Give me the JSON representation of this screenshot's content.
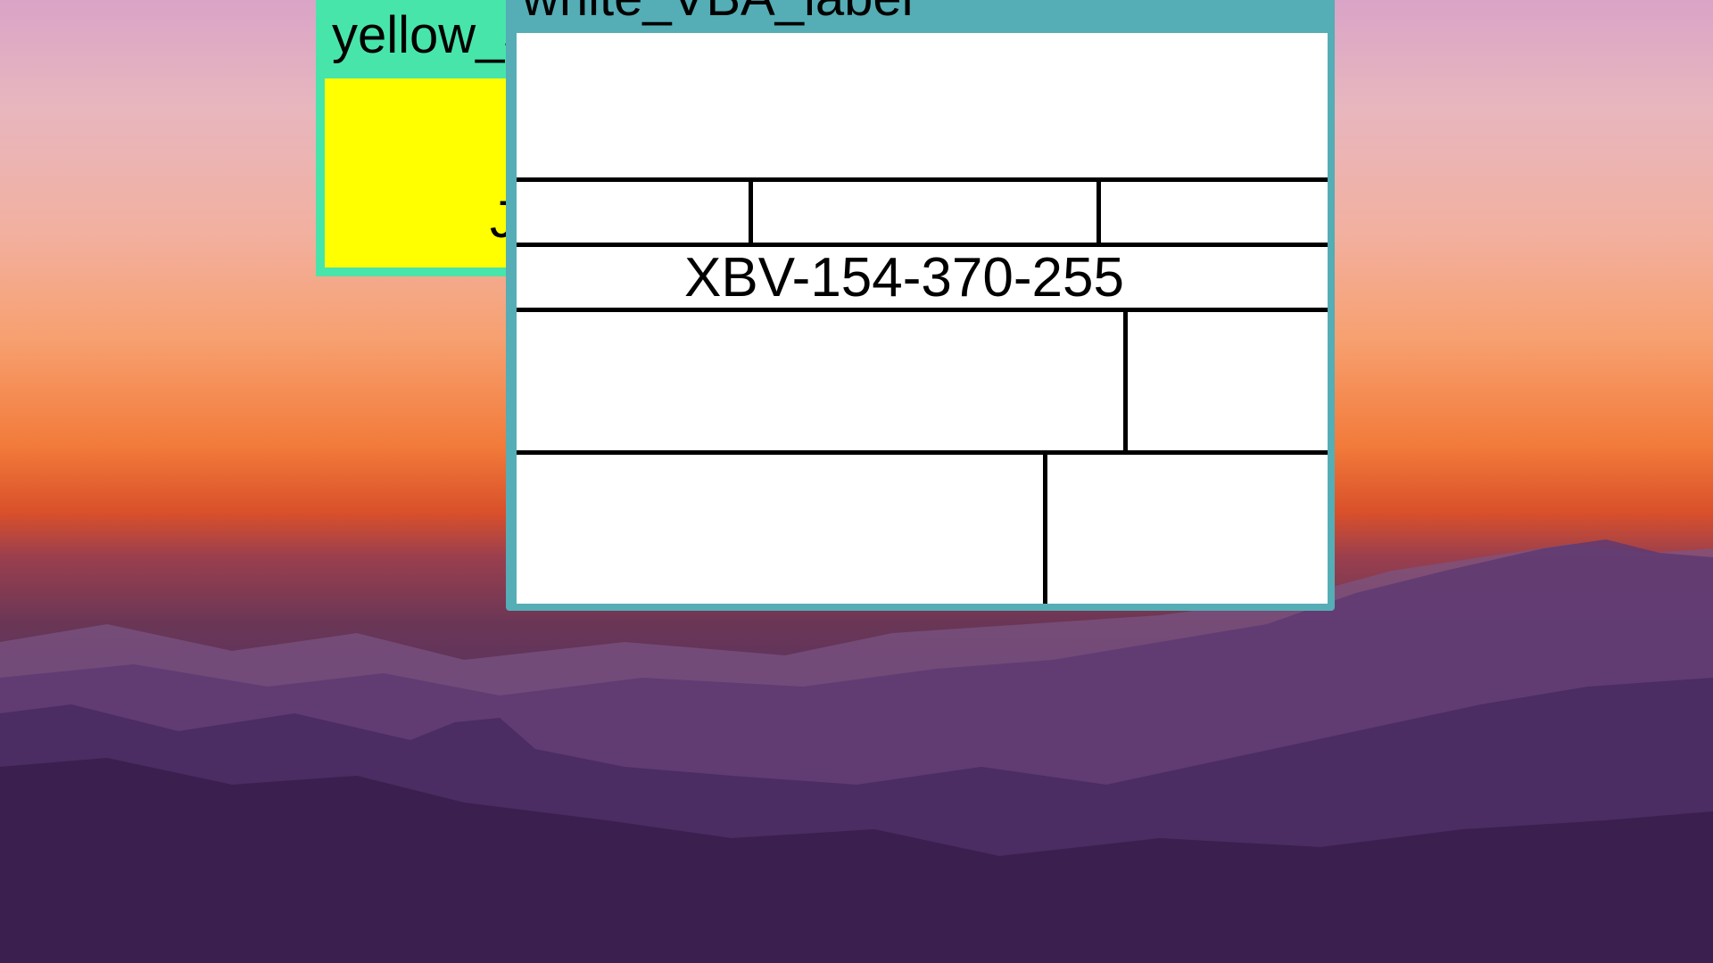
{
  "desktop": {
    "wallpaper": "sunset-over-mountains"
  },
  "windows": {
    "yellow": {
      "title": "yellow_JQXV_label",
      "content_text": "J",
      "colors": {
        "frame": "#48e5ab",
        "content": "#ffff00"
      }
    },
    "white": {
      "title": "white_VBA_label",
      "code": "XBV-154-370-255",
      "colors": {
        "frame": "#55adb5",
        "content": "#ffffff"
      }
    }
  }
}
